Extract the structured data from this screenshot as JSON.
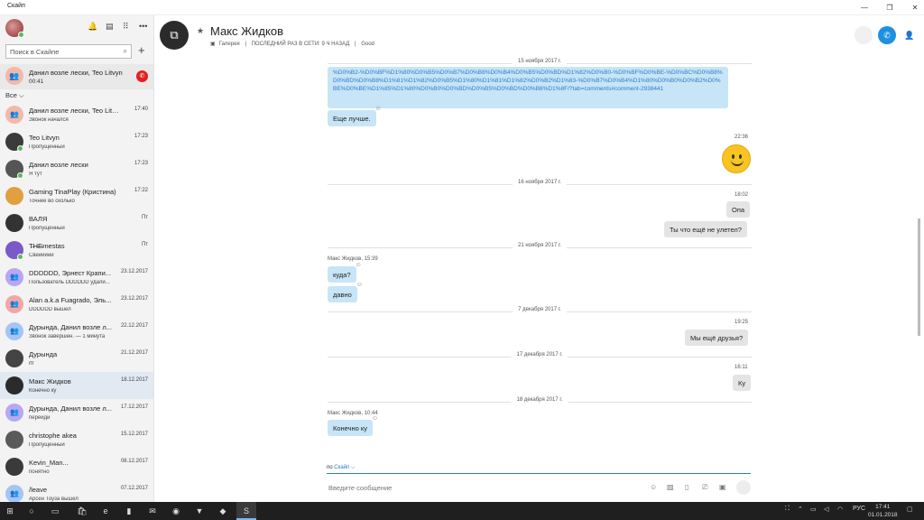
{
  "window": {
    "title": "Скайп"
  },
  "sidebar": {
    "search_placeholder": "Поиск в Скайпе",
    "filter_label": "Все",
    "active_call": {
      "name": "Данил возле лески, Teo Litvyn",
      "duration": "00:41"
    },
    "chats": [
      {
        "name": "Данил возле лески, Teo Litvyn",
        "sub": "Звонок начался",
        "date": "17:40",
        "avatar_color": "#f4b9a6",
        "avatar_text": "👥",
        "online": false
      },
      {
        "name": "Teo Litvyn",
        "sub": "Пропущенный",
        "date": "17:23",
        "avatar_color": "#3b3b3b",
        "avatar_text": "",
        "online": true
      },
      {
        "name": "Данил возле лески",
        "sub": "Я тут",
        "date": "17:23",
        "avatar_color": "#555555",
        "avatar_text": "",
        "online": true
      },
      {
        "name": "Gaming TinaPlay (Кристина)",
        "sub": "Точнее во сколько",
        "date": "17:22",
        "avatar_color": "#e0a040",
        "avatar_text": "",
        "online": false
      },
      {
        "name": "ВАЛЯ",
        "sub": "Пропущенный",
        "date": "Пт",
        "avatar_color": "#333333",
        "avatar_text": "",
        "online": false
      },
      {
        "name": "T̶H̶E̶rnestas",
        "sub": "Свеиииии",
        "date": "Пт",
        "avatar_color": "#7a5ac8",
        "avatar_text": "",
        "online": true
      },
      {
        "name": "DDDDDD, Эрнест Крапи...",
        "sub": "Пользователь DDDDDD удали...",
        "date": "23.12.2017",
        "avatar_color": "#b9a6f4",
        "avatar_text": "👥",
        "online": false
      },
      {
        "name": "Alan a.k.a Fuagrado, Эль...",
        "sub": "DDDDDD вышел",
        "date": "23.12.2017",
        "avatar_color": "#f4a6a6",
        "avatar_text": "👥",
        "online": false
      },
      {
        "name": "Дурында, Данил возле л...",
        "sub": "Звонок завершен. — 1 минута",
        "date": "22.12.2017",
        "avatar_color": "#a6c4f4",
        "avatar_text": "👥",
        "online": false
      },
      {
        "name": "Дурында",
        "sub": "rfr",
        "date": "21.12.2017",
        "avatar_color": "#444444",
        "avatar_text": "",
        "online": false
      },
      {
        "name": "Макс Жидков",
        "sub": "Конечно ку",
        "date": "18.12.2017",
        "avatar_color": "#2b2b2b",
        "avatar_text": "",
        "online": false
      },
      {
        "name": "Дурында, Данил возле л...",
        "sub": "перейди",
        "date": "17.12.2017",
        "avatar_color": "#b9a6f4",
        "avatar_text": "👥",
        "online": false
      },
      {
        "name": "christophe akea",
        "sub": "Пропущенный",
        "date": "15.12.2017",
        "avatar_color": "#5a5a5a",
        "avatar_text": "",
        "online": false
      },
      {
        "name": "Kevin_Man...",
        "sub": "понятно",
        "date": "08.12.2017",
        "avatar_color": "#3a3a3a",
        "avatar_text": "",
        "online": false
      },
      {
        "name": "/leave",
        "sub": "Арсен Тоуза вышел",
        "date": "07.12.2017",
        "avatar_color": "#a6c4f4",
        "avatar_text": "👥",
        "online": false
      }
    ]
  },
  "header": {
    "name": "Макс Жидков",
    "gallery": "Галерея",
    "last_seen": "ПОСЛЕДНИЙ РАЗ В СЕТИ: 9 Ч НАЗАД",
    "mood": "Good"
  },
  "messages": {
    "link_text": "%D0%B2-%D0%BF%D1%80%D0%B5%D0%B7%D0%B8%D0%B4%D0%B5%D0%BD%D1%82%D0%B0-%D0%BF%D0%BE-%D0%BC%D0%B8%D0%BD%D0%B8%D1%81%D1%82%D0%B5%D1%80%D1%81%D1%82%D0%B2%D1%83-%D0%B7%D0%B4%D1%80%D0%B0%D0%B2%D0%BE%D0%BE%D1%85%D1%80%D0%B0%D0%BD%D0%B5%D0%BD%D0%B8%D1%8F/?tab=comments#comment-2938441",
    "d1": "15 ноября 2017 г.",
    "m_better": "Еще лучше.",
    "t_emoji": "22:36",
    "d2": "16 ноября 2017 г.",
    "t_opa": "18:02",
    "m_opa": "Опа",
    "m_not_flown": "Ты что ещё не улетел?",
    "d3": "21 ноября 2017 г.",
    "s_max1": "Макс Жидков, 15:39",
    "m_kuda": "куда?",
    "m_davno": "давно",
    "d4": "7 декабря 2017 г.",
    "t_friends": "19:25",
    "m_friends": "Мы ещё друзья?",
    "d5": "17 декабря 2017 г.",
    "t_ku": "16:11",
    "m_ku": "Ку",
    "d6": "18 декабря 2017 г.",
    "s_max2": "Макс Жидков, 10:44",
    "m_konechno": "Конечно ку"
  },
  "composer": {
    "via_prefix": "по",
    "via_service": "Скайп",
    "placeholder": "Введите сообщение"
  },
  "taskbar": {
    "lang": "РУС",
    "time": "17:41",
    "date": "01.01.2018"
  }
}
